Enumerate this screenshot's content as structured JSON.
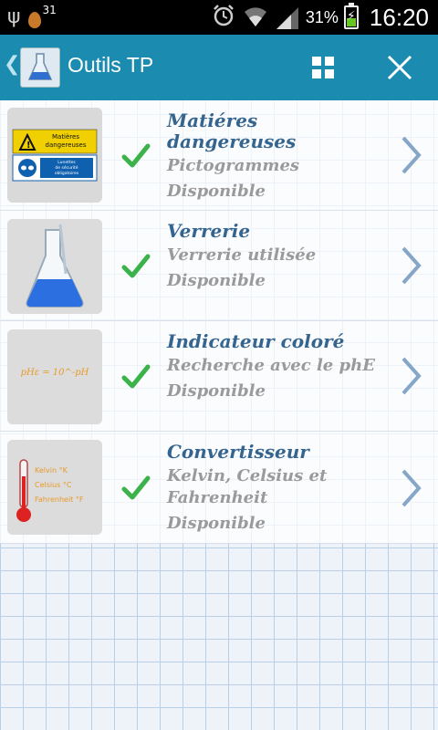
{
  "status_bar": {
    "notification_count": "31",
    "battery": "31%",
    "time": "16:20",
    "icons": [
      "usb-icon",
      "notification-icon",
      "alarm-icon",
      "wifi-icon",
      "signal-icon",
      "battery-charging-icon"
    ]
  },
  "action_bar": {
    "title": "Outils TP",
    "color": "#1b8bb0",
    "actions": [
      "grid-icon",
      "close-icon"
    ]
  },
  "items": [
    {
      "title_lines": [
        "Matiéres",
        "dangereuses"
      ],
      "subtitle_lines": [
        "Pictogrammes"
      ],
      "status": "Disponible",
      "thumb": {
        "icon": "hazard-signs-thumbnail",
        "top_label_lines": [
          "Matières",
          "dangereuses"
        ],
        "bottom_label_lines": [
          "Lunettes",
          "de sécurité",
          "obligatoires"
        ]
      }
    },
    {
      "title_lines": [
        "Verrerie"
      ],
      "subtitle_lines": [
        "Verrerie utilisée"
      ],
      "status": "Disponible",
      "thumb": {
        "icon": "erlenmeyer-flask-thumbnail"
      }
    },
    {
      "title_lines": [
        "Indicateur coloré"
      ],
      "subtitle_lines": [
        "Recherche avec le phE"
      ],
      "status": "Disponible",
      "thumb": {
        "icon": "ph-formula-thumbnail",
        "formula": "pHε = 10^-pH"
      }
    },
    {
      "title_lines": [
        "Convertisseur"
      ],
      "subtitle_lines": [
        "Kelvin, Celsius et",
        "Fahrenheit"
      ],
      "status": "Disponible",
      "thumb": {
        "icon": "thermometer-thumbnail",
        "labels": [
          "Kelvin °K",
          "Celsius °C",
          "Fahrenheit °F"
        ]
      }
    }
  ]
}
